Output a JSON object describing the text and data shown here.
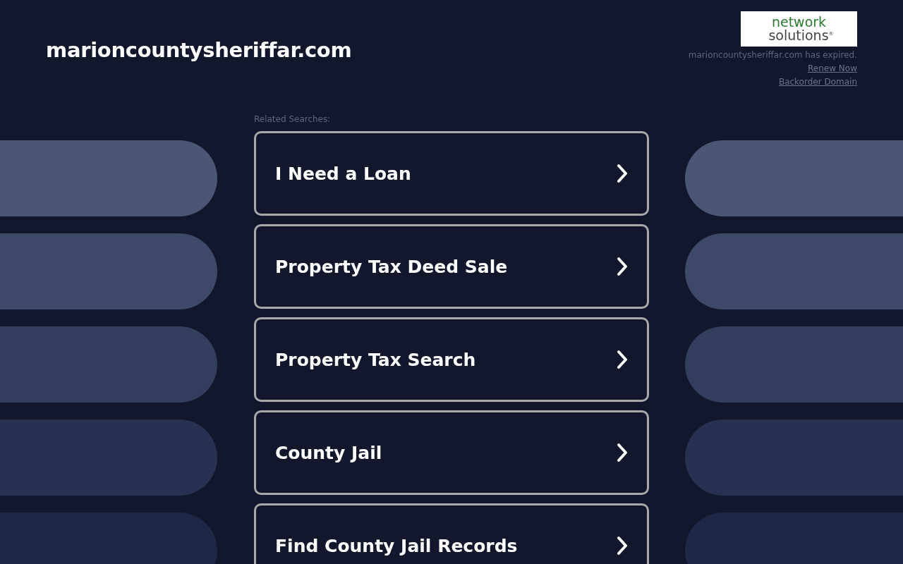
{
  "header": {
    "domain": "marioncountysheriffar.com",
    "logo": {
      "line_1": "network",
      "line_2": "solutions$^{®}$"
    },
    "notice": "marioncountysheriffar.com has expired.",
    "links": [
      "Renew Now",
      "Backorder Domain"
    ]
  },
  "related": {
    "heading": "Related Searches:",
    "items": [
      {
        "label": "I Need a Loan"
      },
      {
        "label": "Property Tax Deed Sale"
      },
      {
        "label": "Property Tax Search"
      },
      {
        "label": "County Jail"
      },
      {
        "label": "Find County Jail Records"
      }
    ]
  }
}
